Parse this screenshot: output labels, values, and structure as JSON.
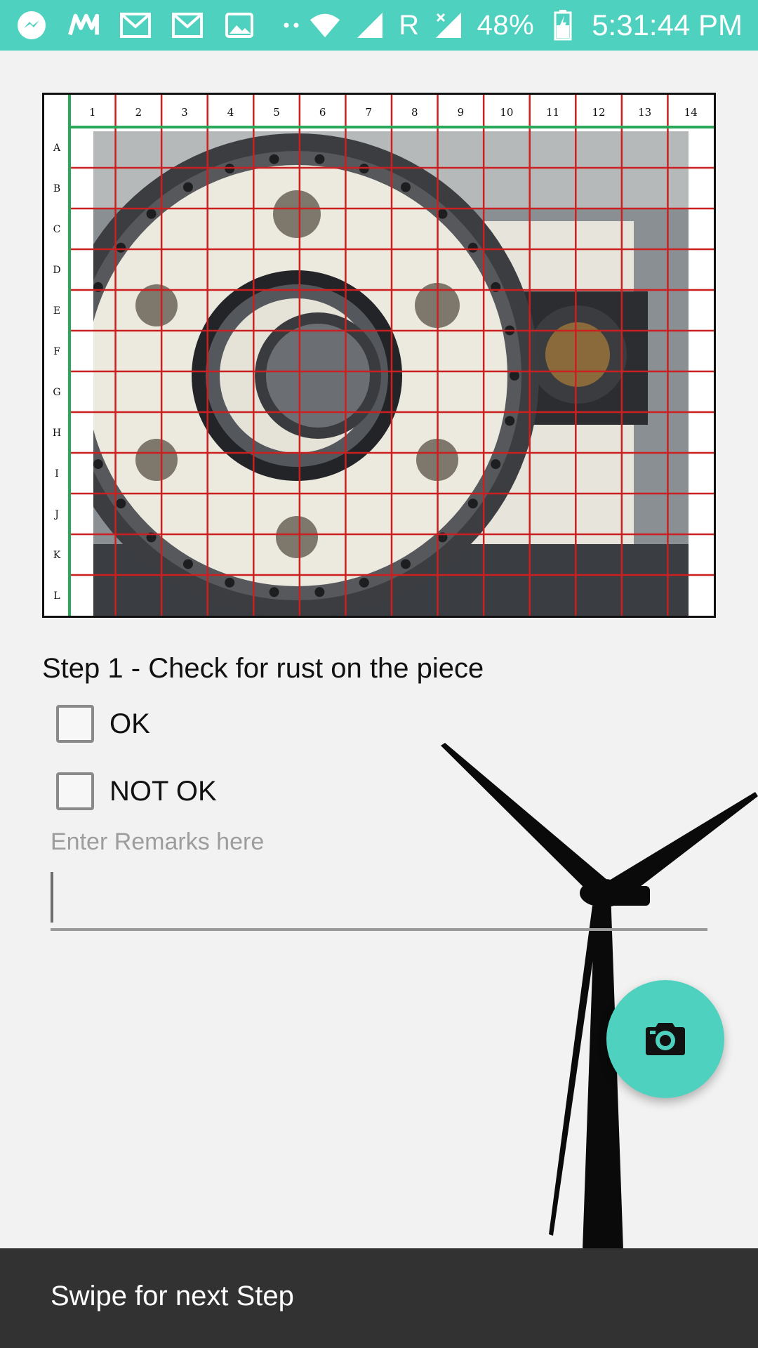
{
  "status_bar": {
    "battery": "48%",
    "time": "5:31:44 PM",
    "network_letter": "R",
    "icons": [
      "messenger-icon",
      "moneycontrol-icon",
      "gmail-icon",
      "gmail-icon",
      "gallery-icon",
      "more-dots-icon",
      "wifi-icon",
      "signal-icon",
      "signal-icon",
      "battery-icon"
    ]
  },
  "grid_image": {
    "columns": [
      "1",
      "2",
      "3",
      "4",
      "5",
      "6",
      "7",
      "8",
      "9",
      "10",
      "11",
      "12",
      "13",
      "14"
    ],
    "rows": [
      "A",
      "B",
      "C",
      "D",
      "E",
      "F",
      "G",
      "H",
      "I",
      "J",
      "K",
      "L"
    ],
    "grid_color": "#cc1f1f",
    "header_line_color": "#2aa85a"
  },
  "step": {
    "title": "Step 1 - Check for rust on the piece",
    "options": [
      {
        "label": "OK",
        "checked": false
      },
      {
        "label": "NOT OK",
        "checked": false
      }
    ]
  },
  "remarks": {
    "placeholder": "Enter Remarks here",
    "value": ""
  },
  "fab": {
    "icon": "camera-icon"
  },
  "bottom_bar": {
    "text": "Swipe for next Step"
  },
  "colors": {
    "accent": "#4fd1bf",
    "background": "#f2f2f2",
    "bottom_bar": "#323232"
  }
}
